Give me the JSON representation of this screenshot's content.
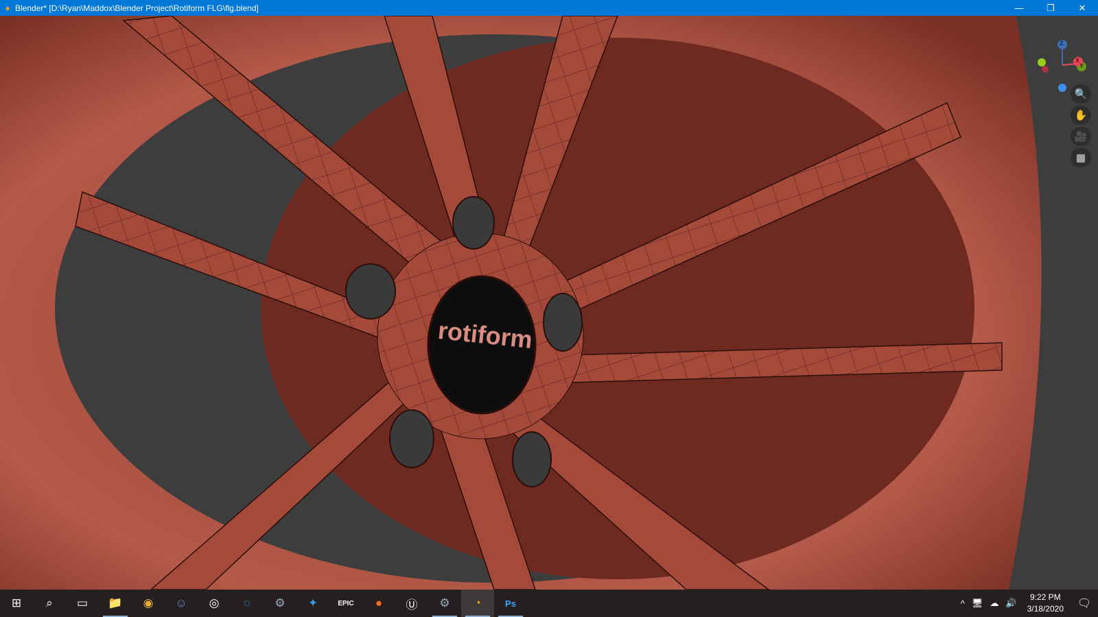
{
  "window": {
    "title": "Blender* [D:\\Ryan\\Maddox\\Blender Project\\Rotiform FLG\\flg.blend]",
    "controls": {
      "minimize": "—",
      "restore": "❐",
      "close": "✕"
    }
  },
  "viewport": {
    "logo_text": "rotiform",
    "gizmo": {
      "z": "Z",
      "x": "X",
      "y": "Y"
    },
    "nav_buttons": [
      {
        "name": "zoom",
        "icon": "🔍"
      },
      {
        "name": "pan",
        "icon": "✋"
      },
      {
        "name": "camera",
        "icon": "🎥"
      },
      {
        "name": "ortho-grid",
        "icon": "▦"
      }
    ],
    "colors": {
      "mesh": "#a4493c",
      "background": "#3d3d3d"
    }
  },
  "taskbar": {
    "apps": [
      {
        "name": "start",
        "icon": "⊞"
      },
      {
        "name": "search",
        "icon": "⌕"
      },
      {
        "name": "task-view",
        "icon": "▭"
      },
      {
        "name": "file-explorer",
        "icon": "📁"
      },
      {
        "name": "chrome",
        "icon": "◉"
      },
      {
        "name": "discord",
        "icon": "☺"
      },
      {
        "name": "obs",
        "icon": "◎"
      },
      {
        "name": "uplay",
        "icon": "◌"
      },
      {
        "name": "steam",
        "icon": "⚙"
      },
      {
        "name": "battle-net",
        "icon": "✦"
      },
      {
        "name": "epic-games",
        "icon": "EPIC"
      },
      {
        "name": "origin",
        "icon": "●"
      },
      {
        "name": "unreal-engine",
        "icon": "Ⓤ"
      },
      {
        "name": "steam-2",
        "icon": "⚙"
      },
      {
        "name": "blender",
        "icon": "◔"
      },
      {
        "name": "photoshop",
        "icon": "Ps"
      }
    ],
    "tray": {
      "chevron": "^",
      "network": "🖥",
      "onedrive": "☁",
      "volume": "🔊"
    },
    "time": "9:22 PM",
    "date": "3/18/2020",
    "notifications": "🗨"
  }
}
